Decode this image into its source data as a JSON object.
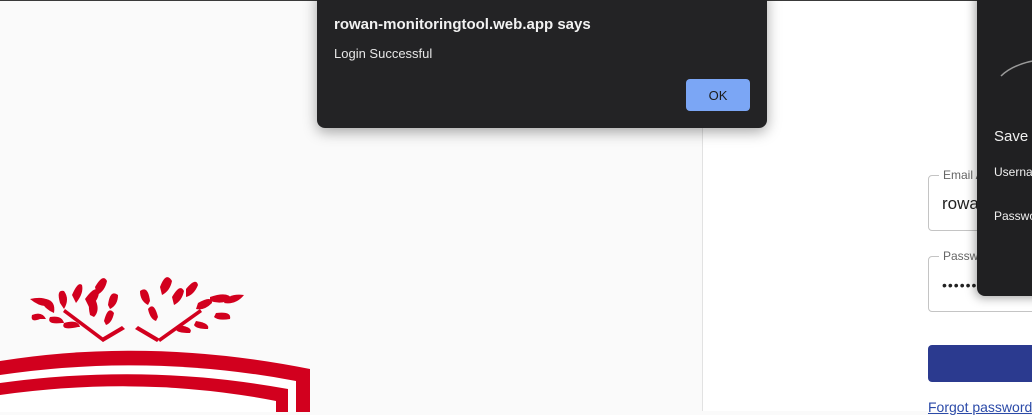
{
  "alert": {
    "title": "rowan-monitoringtool.web.app says",
    "message": "Login Successful",
    "ok_label": "OK"
  },
  "login": {
    "email_label": "Email A",
    "email_value": "rowa",
    "password_label": "Passw",
    "password_value": "••••••",
    "forgot_label": "Forgot password"
  },
  "save_password": {
    "title": "Save",
    "username_label": "Userna",
    "password_label": "Passwo"
  },
  "colors": {
    "brand_red": "#d2001e",
    "login_button": "#2b3a8f",
    "ok_button": "#7ba6f5"
  }
}
